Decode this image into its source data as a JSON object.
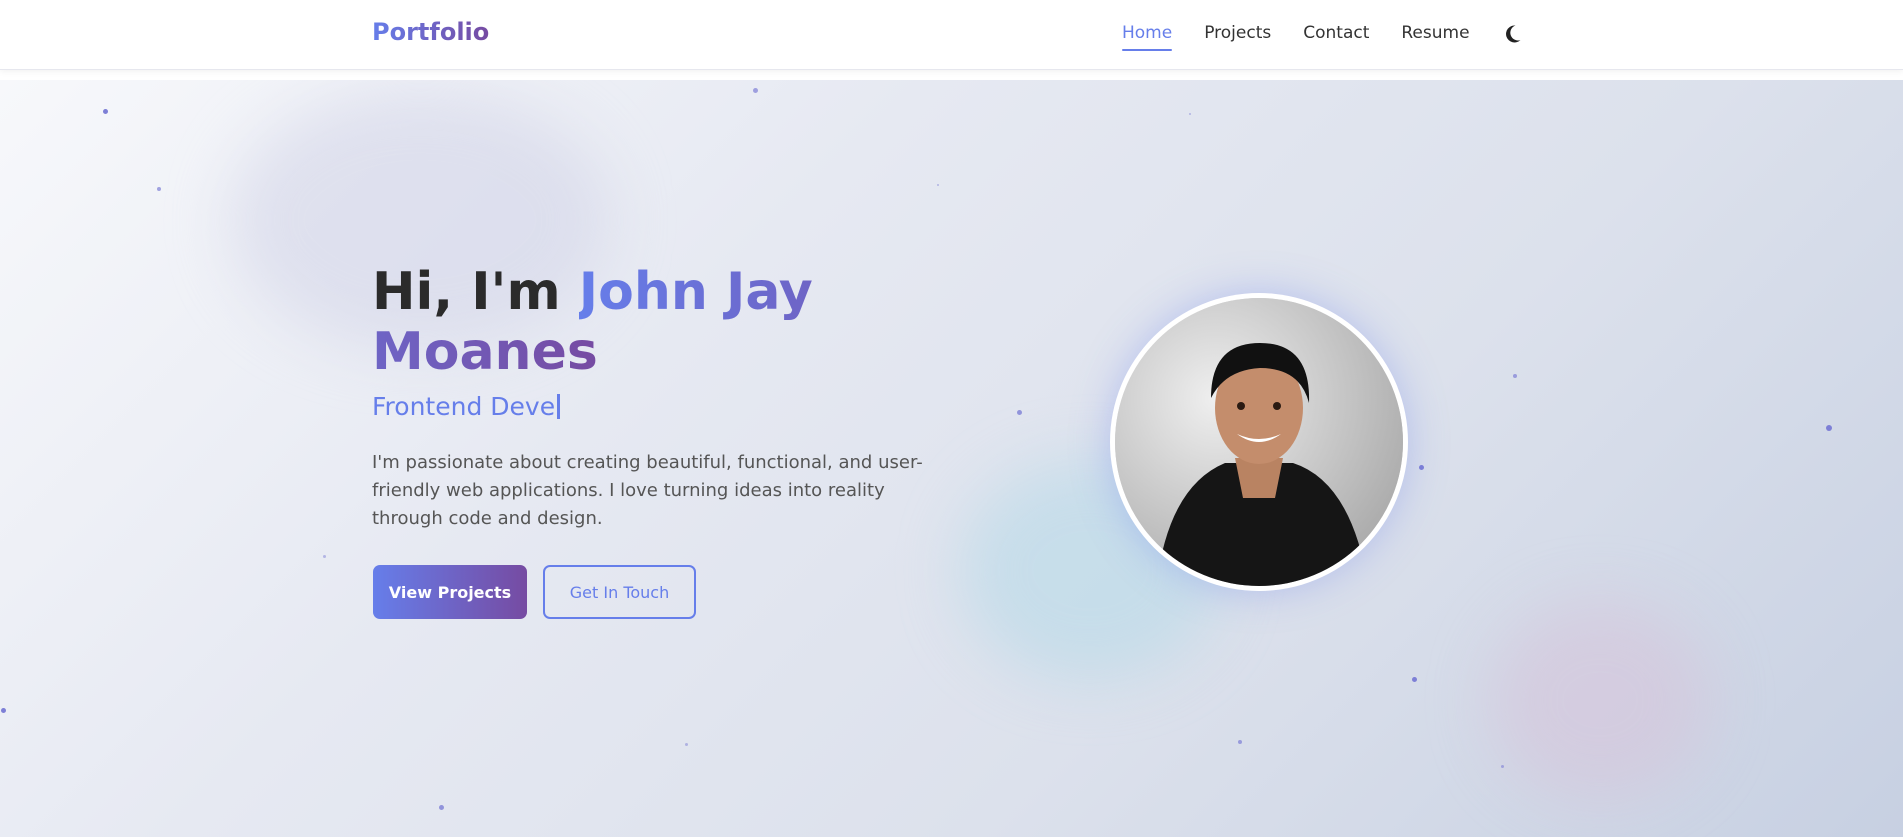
{
  "nav": {
    "brand": "Portfolio",
    "links": [
      "Home",
      "Projects",
      "Contact",
      "Resume"
    ],
    "active": "Home",
    "theme_icon": "moon-icon"
  },
  "hero": {
    "greeting": "Hi, I'm ",
    "name": "John Jay Moanes",
    "typing_text": "Frontend Deve",
    "description": "I'm passionate about creating beautiful, functional, and user-friendly web applications. I love turning ideas into reality through code and design.",
    "primary_button": "View Projects",
    "secondary_button": "Get In Touch",
    "photo": "profile-photo"
  },
  "colors": {
    "accent": "#667eea",
    "accent_secondary": "#764ba2",
    "text_dark": "#2b2b2b"
  }
}
